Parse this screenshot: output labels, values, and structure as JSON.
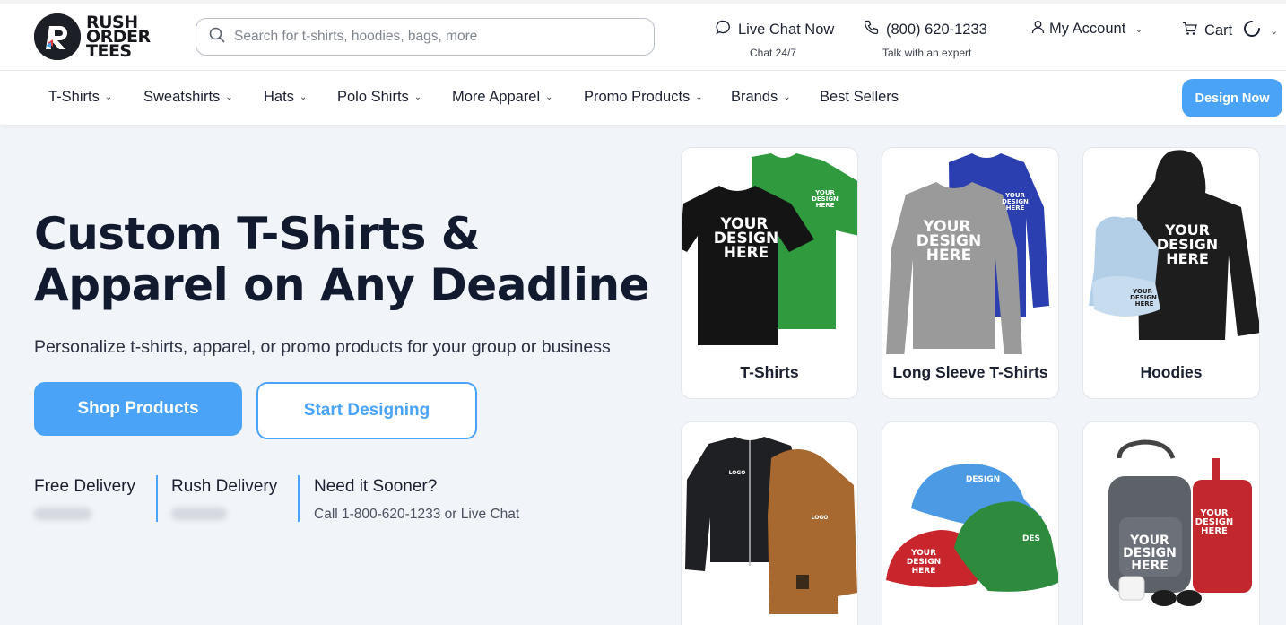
{
  "header": {
    "logo_lines": [
      "RUSH",
      "ORDER",
      "TEES"
    ],
    "search_placeholder": "Search for t-shirts, hoodies, bags, more",
    "live_chat": {
      "label": "Live Chat Now",
      "sub": "Chat 24/7"
    },
    "phone": {
      "label": "(800) 620-1233",
      "sub": "Talk with an expert"
    },
    "account": {
      "label": "My Account"
    },
    "cart": {
      "label": "Cart"
    }
  },
  "nav": {
    "items": [
      {
        "label": "T-Shirts"
      },
      {
        "label": "Sweatshirts"
      },
      {
        "label": "Hats"
      },
      {
        "label": "Polo Shirts"
      },
      {
        "label": "More Apparel"
      },
      {
        "label": "Promo Products"
      },
      {
        "label": "Brands"
      },
      {
        "label": "Best Sellers"
      }
    ],
    "cta": "Design Now"
  },
  "hero": {
    "title_line1": "Custom T-Shirts &",
    "title_line2": "Apparel on Any Deadline",
    "subtitle": "Personalize t-shirts, apparel, or promo products for your group or business",
    "primary_button": "Shop Products",
    "secondary_button": "Start Designing",
    "delivery": {
      "free": "Free Delivery",
      "rush": "Rush Delivery",
      "sooner_title": "Need it Sooner?",
      "sooner_text": "Call 1-800-620-1233 or Live Chat"
    }
  },
  "products": [
    {
      "label": "T-Shirts",
      "mockup_text": "YOUR DESIGN HERE"
    },
    {
      "label": "Long Sleeve T-Shirts",
      "mockup_text": "YOUR DESIGN HERE"
    },
    {
      "label": "Hoodies",
      "mockup_text": "YOUR DESIGN HERE"
    },
    {
      "label": "",
      "mockup_text": "LOGO"
    },
    {
      "label": "",
      "mockup_text": "YOUR DESIGN HERE"
    },
    {
      "label": "",
      "mockup_text": "YOUR DESIGN HERE"
    }
  ],
  "colors": {
    "accent": "#4aa3f6",
    "text": "#111a2e",
    "background": "#f1f4f8"
  }
}
